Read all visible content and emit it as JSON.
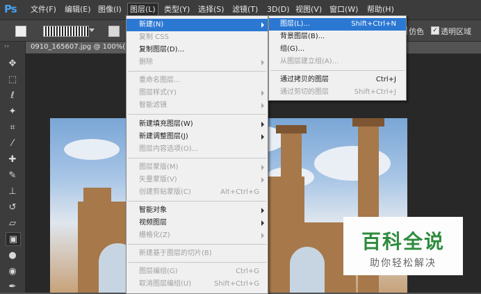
{
  "app": {
    "logo": "Ps"
  },
  "menubar": [
    {
      "label": "文件(F)",
      "active": false
    },
    {
      "label": "编辑(E)",
      "active": false
    },
    {
      "label": "图像(I)",
      "active": false
    },
    {
      "label": "图层(L)",
      "active": true
    },
    {
      "label": "类型(Y)",
      "active": false
    },
    {
      "label": "选择(S)",
      "active": false
    },
    {
      "label": "滤镜(T)",
      "active": false
    },
    {
      "label": "3D(D)",
      "active": false
    },
    {
      "label": "视图(V)",
      "active": false
    },
    {
      "label": "窗口(W)",
      "active": false
    },
    {
      "label": "帮助(H)",
      "active": false
    }
  ],
  "options": {
    "dither_label": "仿色",
    "dither_checked": true,
    "transparency_label": "透明区域",
    "transparency_checked": true
  },
  "document": {
    "tab_title": "0910_165607.jpg @ 100%(RGB/8)"
  },
  "tools": [
    {
      "icon": "move-icon",
      "glyph": "✥"
    },
    {
      "icon": "marquee-icon",
      "glyph": "⬚"
    },
    {
      "icon": "lasso-icon",
      "glyph": "ℓ"
    },
    {
      "icon": "magic-wand-icon",
      "glyph": "✦"
    },
    {
      "icon": "crop-icon",
      "glyph": "⌗"
    },
    {
      "icon": "eyedropper-icon",
      "glyph": "⁄"
    },
    {
      "icon": "healing-brush-icon",
      "glyph": "✚"
    },
    {
      "icon": "brush-icon",
      "glyph": "✎"
    },
    {
      "icon": "stamp-icon",
      "glyph": "⊥"
    },
    {
      "icon": "history-brush-icon",
      "glyph": "↺"
    },
    {
      "icon": "eraser-icon",
      "glyph": "▱"
    },
    {
      "icon": "gradient-icon",
      "glyph": "▣",
      "selected": true
    },
    {
      "icon": "blur-icon",
      "glyph": "●"
    },
    {
      "icon": "dodge-icon",
      "glyph": "◉"
    },
    {
      "icon": "pen-icon",
      "glyph": "✒"
    }
  ],
  "layer_menu": [
    {
      "label": "新建(N)",
      "shortcut": "",
      "submenu": true,
      "disabled": false,
      "highlighted": true
    },
    {
      "label": "复制 CSS",
      "shortcut": "",
      "submenu": false,
      "disabled": true
    },
    {
      "label": "复制图层(D)...",
      "shortcut": "",
      "submenu": false,
      "disabled": false
    },
    {
      "label": "删除",
      "shortcut": "",
      "submenu": true,
      "disabled": true,
      "sep_after": true
    },
    {
      "label": "重命名图层...",
      "shortcut": "",
      "submenu": false,
      "disabled": true
    },
    {
      "label": "图层样式(Y)",
      "shortcut": "",
      "submenu": true,
      "disabled": true
    },
    {
      "label": "智能滤镜",
      "shortcut": "",
      "submenu": true,
      "disabled": true,
      "sep_after": true
    },
    {
      "label": "新建填充图层(W)",
      "shortcut": "",
      "submenu": true,
      "disabled": false
    },
    {
      "label": "新建调整图层(J)",
      "shortcut": "",
      "submenu": true,
      "disabled": false
    },
    {
      "label": "图层内容选项(O)...",
      "shortcut": "",
      "submenu": false,
      "disabled": true,
      "sep_after": true
    },
    {
      "label": "图层蒙版(M)",
      "shortcut": "",
      "submenu": true,
      "disabled": true
    },
    {
      "label": "矢量蒙版(V)",
      "shortcut": "",
      "submenu": true,
      "disabled": true
    },
    {
      "label": "创建剪贴蒙版(C)",
      "shortcut": "Alt+Ctrl+G",
      "submenu": false,
      "disabled": true,
      "sep_after": true
    },
    {
      "label": "智能对象",
      "shortcut": "",
      "submenu": true,
      "disabled": false
    },
    {
      "label": "视频图层",
      "shortcut": "",
      "submenu": true,
      "disabled": false
    },
    {
      "label": "栅格化(Z)",
      "shortcut": "",
      "submenu": true,
      "disabled": true,
      "sep_after": true
    },
    {
      "label": "新建基于图层的切片(B)",
      "shortcut": "",
      "submenu": false,
      "disabled": true,
      "sep_after": true
    },
    {
      "label": "图层编组(G)",
      "shortcut": "Ctrl+G",
      "submenu": false,
      "disabled": true
    },
    {
      "label": "取消图层编组(U)",
      "shortcut": "Shift+Ctrl+G",
      "submenu": false,
      "disabled": true
    }
  ],
  "new_submenu": [
    {
      "label": "图层(L)...",
      "shortcut": "Shift+Ctrl+N",
      "disabled": false,
      "highlighted": true
    },
    {
      "label": "背景图层(B)...",
      "shortcut": "",
      "disabled": false
    },
    {
      "label": "组(G)...",
      "shortcut": "",
      "disabled": false
    },
    {
      "label": "从图层建立组(A)...",
      "shortcut": "",
      "disabled": true,
      "sep_after": true
    },
    {
      "label": "通过拷贝的图层",
      "shortcut": "Ctrl+J",
      "disabled": false
    },
    {
      "label": "通过剪切的图层",
      "shortcut": "Shift+Ctrl+J",
      "disabled": true
    }
  ],
  "watermark": {
    "title": "百科全说",
    "subtitle": "助你轻松解决"
  }
}
